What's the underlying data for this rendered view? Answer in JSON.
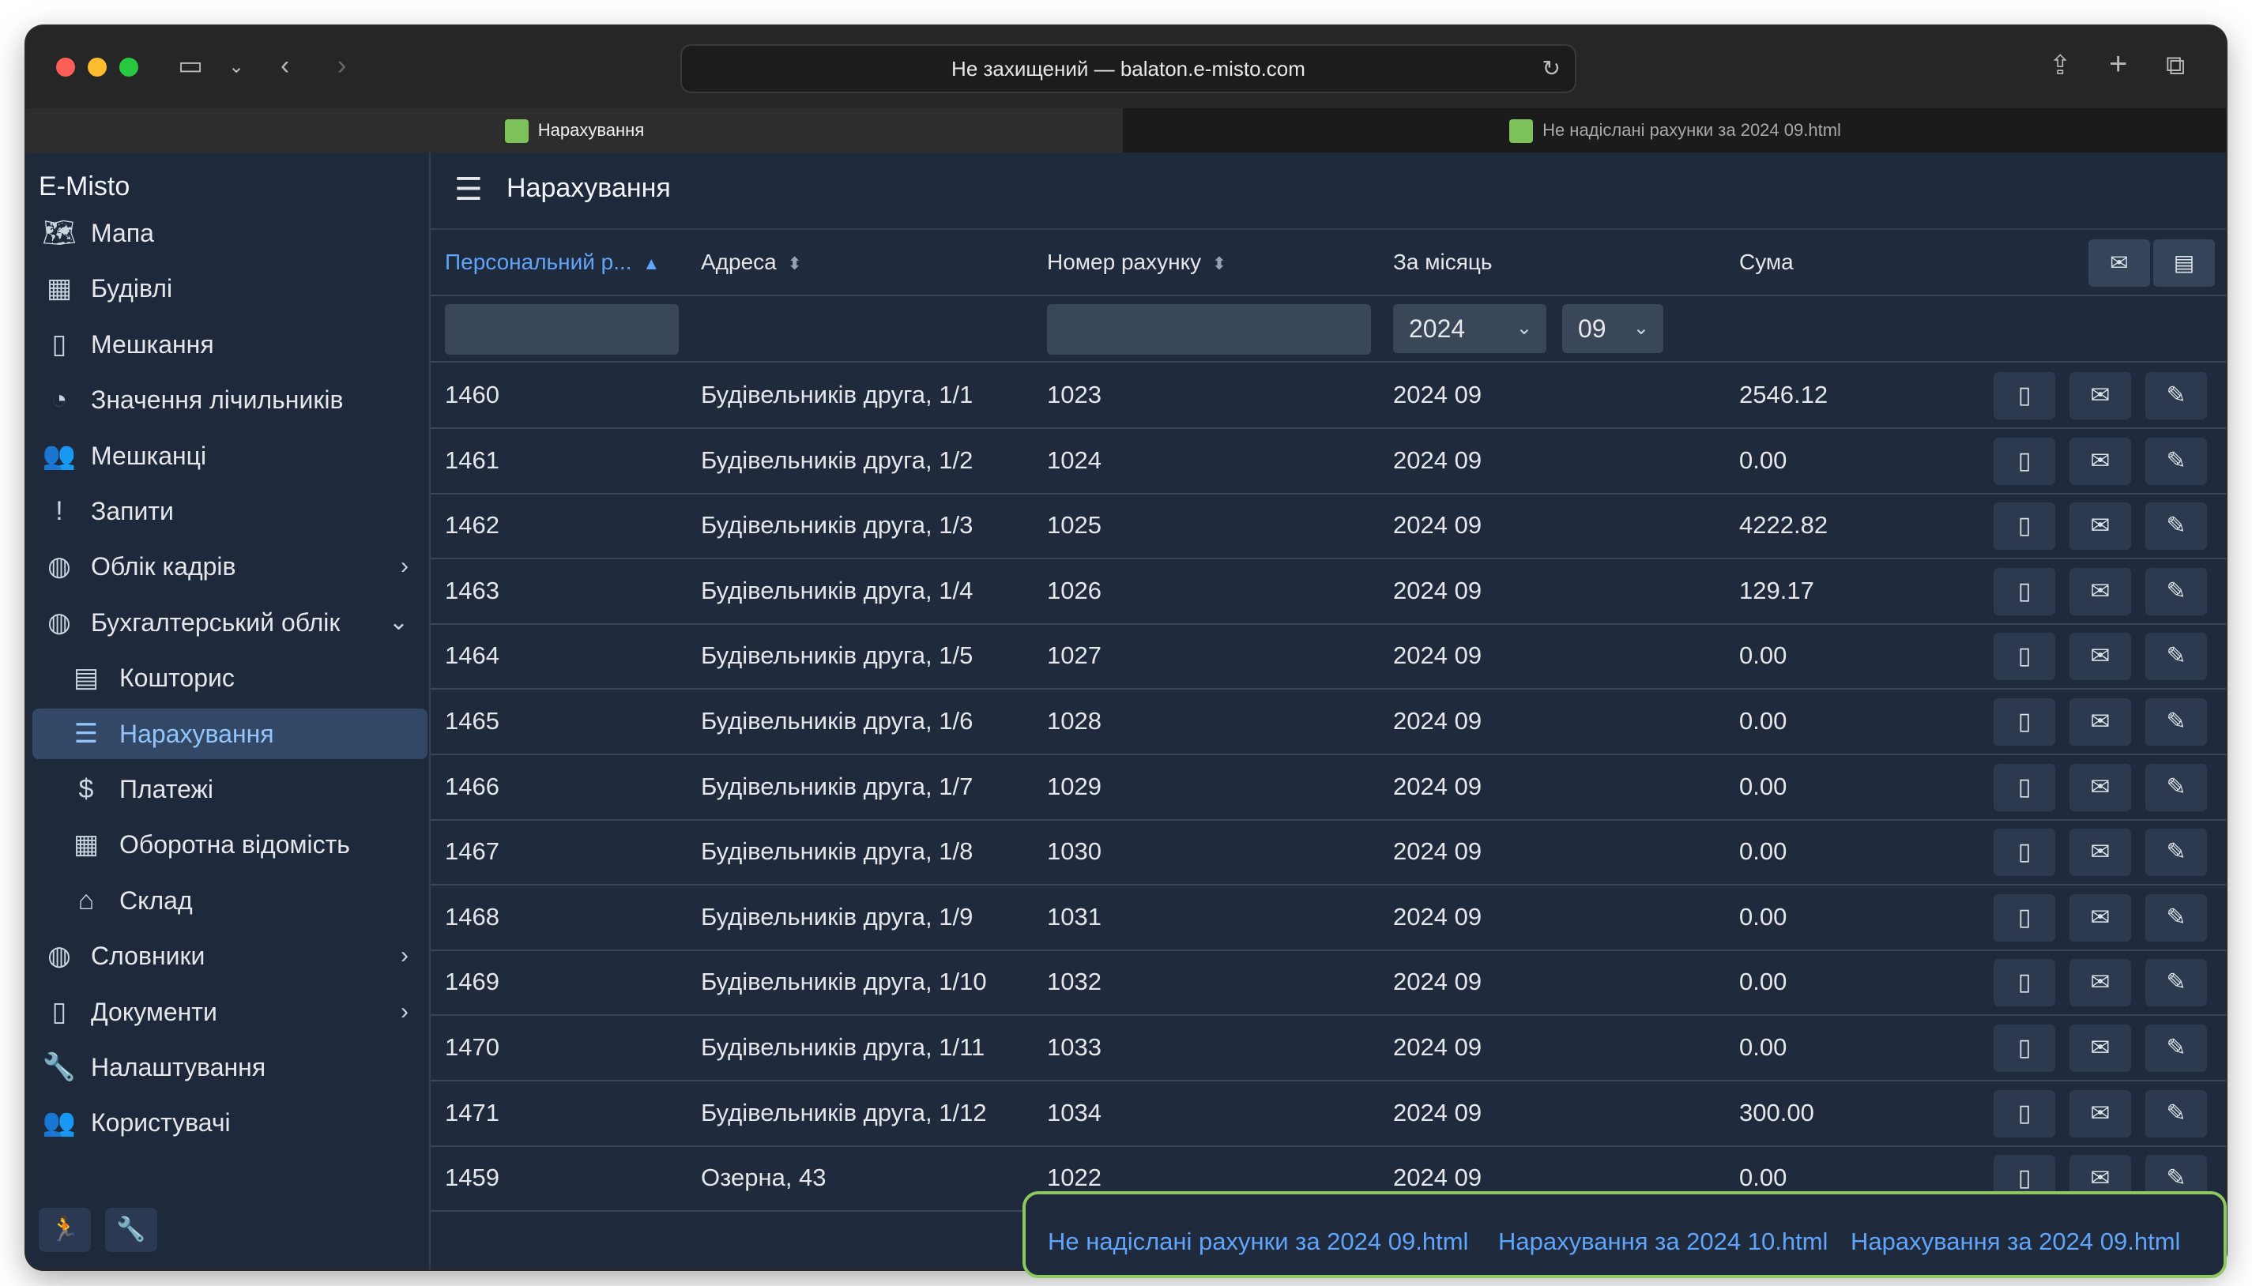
{
  "browser": {
    "url_text": "Не захищений — balaton.e-misto.com",
    "tabs": [
      {
        "label": "Нарахування",
        "active": true
      },
      {
        "label": "Не надіслані рахунки за 2024 09.html",
        "active": false
      }
    ],
    "icons": {
      "sidebar": "sidebar-toggle-icon",
      "back": "chevron-left-icon",
      "forward": "chevron-right-icon",
      "reload": "reload-icon",
      "share": "share-icon",
      "new_tab": "plus-icon",
      "tabs_overview": "tabs-overview-icon"
    },
    "traffic_lights": {
      "close": "#ff5f57",
      "minimize": "#febc2e",
      "zoom": "#28c840"
    },
    "favicon_color": "#7cc15a"
  },
  "app": {
    "brand": "E-Misto",
    "page_title": "Нарахування",
    "accent_color": "#60a5fa"
  },
  "sidebar": {
    "items": [
      {
        "label": "Мапа",
        "icon": "map-icon",
        "glyph": "🗺"
      },
      {
        "label": "Будівлі",
        "icon": "building-icon",
        "glyph": "▦"
      },
      {
        "label": "Мешкання",
        "icon": "door-icon",
        "glyph": "▯"
      },
      {
        "label": "Значення лічильників",
        "icon": "gauge-icon",
        "glyph": "◔"
      },
      {
        "label": "Мешканці",
        "icon": "people-icon",
        "glyph": "👥"
      },
      {
        "label": "Запити",
        "icon": "exclamation-icon",
        "glyph": "!"
      },
      {
        "label": "Облік кадрів",
        "icon": "globe-icon",
        "glyph": "◍",
        "chevron": "›"
      },
      {
        "label": "Бухгалтерський облік",
        "icon": "globe-icon",
        "glyph": "◍",
        "chevron": "⌄"
      },
      {
        "label": "Кошторис",
        "icon": "calculator-book-icon",
        "glyph": "▤",
        "sub": true
      },
      {
        "label": "Нарахування",
        "icon": "invoice-icon",
        "glyph": "☰",
        "sub": true,
        "selected": true
      },
      {
        "label": "Платежі",
        "icon": "dollar-icon",
        "glyph": "$",
        "sub": true
      },
      {
        "label": "Оборотна відомість",
        "icon": "table-icon",
        "glyph": "▦",
        "sub": true
      },
      {
        "label": "Склад",
        "icon": "warehouse-icon",
        "glyph": "⌂",
        "sub": true
      },
      {
        "label": "Словники",
        "icon": "globe-icon",
        "glyph": "◍",
        "chevron": "›"
      },
      {
        "label": "Документи",
        "icon": "document-icon",
        "glyph": "▯",
        "chevron": "›"
      },
      {
        "label": "Налаштування",
        "icon": "wrench-icon",
        "glyph": "🔧"
      },
      {
        "label": "Користувачі",
        "icon": "people-icon",
        "glyph": "👥"
      }
    ],
    "footer_buttons": [
      {
        "icon": "run-icon",
        "glyph": "🏃"
      },
      {
        "icon": "wrench-icon",
        "glyph": "🔧"
      }
    ]
  },
  "table": {
    "columns": [
      {
        "label": "Персональний р...",
        "sort": "▲",
        "sorted": true
      },
      {
        "label": "Адреса",
        "sort": "⬍"
      },
      {
        "label": "Номер рахунку",
        "sort": "⬍"
      },
      {
        "label": "За місяць",
        "sort": ""
      },
      {
        "label": "Сума",
        "sort": ""
      }
    ],
    "header_buttons": [
      {
        "icon": "envelope-icon",
        "glyph": "✉"
      },
      {
        "icon": "invoice-icon",
        "glyph": "▤"
      }
    ],
    "filters": {
      "personal_account": "",
      "invoice_number": "",
      "year": "2024",
      "month": "09"
    },
    "row_actions": [
      {
        "icon": "document-icon",
        "glyph": "▯"
      },
      {
        "icon": "envelope-icon",
        "glyph": "✉"
      },
      {
        "icon": "edit-icon",
        "glyph": "✎"
      }
    ],
    "rows": [
      {
        "account": "1460",
        "address": "Будівельників друга, 1/1",
        "invoice": "1023",
        "month": "2024 09",
        "sum": "2546.12"
      },
      {
        "account": "1461",
        "address": "Будівельників друга, 1/2",
        "invoice": "1024",
        "month": "2024 09",
        "sum": "0.00"
      },
      {
        "account": "1462",
        "address": "Будівельників друга, 1/3",
        "invoice": "1025",
        "month": "2024 09",
        "sum": "4222.82"
      },
      {
        "account": "1463",
        "address": "Будівельників друга, 1/4",
        "invoice": "1026",
        "month": "2024 09",
        "sum": "129.17"
      },
      {
        "account": "1464",
        "address": "Будівельників друга, 1/5",
        "invoice": "1027",
        "month": "2024 09",
        "sum": "0.00"
      },
      {
        "account": "1465",
        "address": "Будівельників друга, 1/6",
        "invoice": "1028",
        "month": "2024 09",
        "sum": "0.00"
      },
      {
        "account": "1466",
        "address": "Будівельників друга, 1/7",
        "invoice": "1029",
        "month": "2024 09",
        "sum": "0.00"
      },
      {
        "account": "1467",
        "address": "Будівельників друга, 1/8",
        "invoice": "1030",
        "month": "2024 09",
        "sum": "0.00"
      },
      {
        "account": "1468",
        "address": "Будівельників друга, 1/9",
        "invoice": "1031",
        "month": "2024 09",
        "sum": "0.00"
      },
      {
        "account": "1469",
        "address": "Будівельників друга, 1/10",
        "invoice": "1032",
        "month": "2024 09",
        "sum": "0.00"
      },
      {
        "account": "1470",
        "address": "Будівельників друга, 1/11",
        "invoice": "1033",
        "month": "2024 09",
        "sum": "0.00"
      },
      {
        "account": "1471",
        "address": "Будівельників друга, 1/12",
        "invoice": "1034",
        "month": "2024 09",
        "sum": "300.00"
      },
      {
        "account": "1459",
        "address": "Озерна, 43",
        "invoice": "1022",
        "month": "2024 09",
        "sum": "0.00"
      }
    ]
  },
  "downloads": [
    "Не надіслані рахунки за 2024 09.html",
    "Нарахування за 2024 10.html",
    "Нарахування за 2024 09.html"
  ]
}
